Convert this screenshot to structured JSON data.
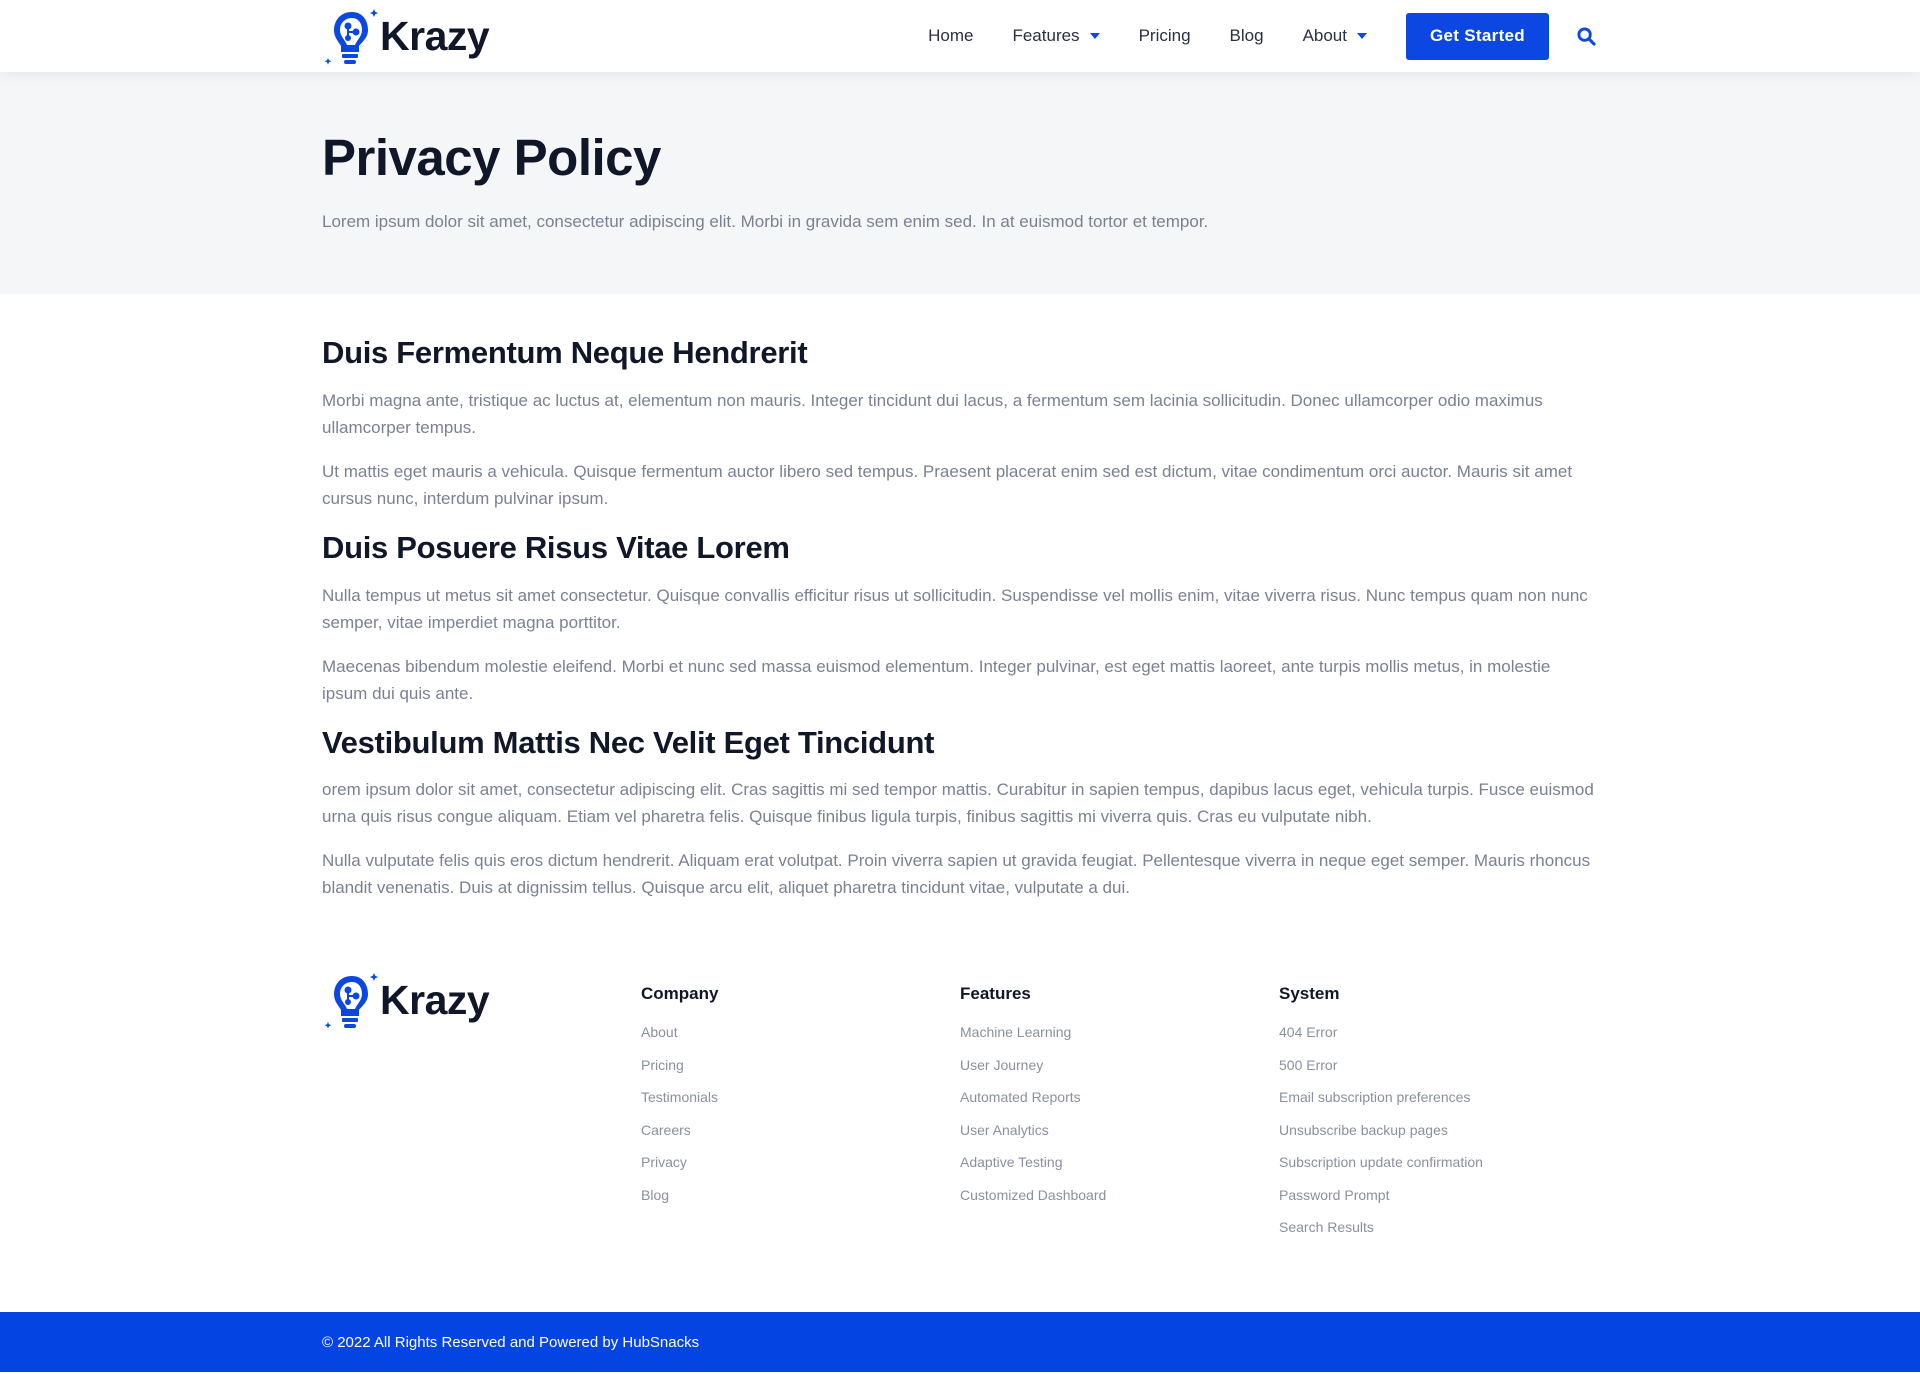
{
  "brand": {
    "name": "Krazy",
    "accent": "#0b47e0"
  },
  "nav": {
    "items": [
      {
        "label": "Home",
        "dropdown": false
      },
      {
        "label": "Features",
        "dropdown": true
      },
      {
        "label": "Pricing",
        "dropdown": false
      },
      {
        "label": "Blog",
        "dropdown": false
      },
      {
        "label": "About",
        "dropdown": true
      }
    ],
    "cta": "Get Started"
  },
  "hero": {
    "title": "Privacy Policy",
    "subtitle": "Lorem ipsum dolor sit amet, consectetur adipiscing elit. Morbi in gravida sem enim sed. In at euismod tortor et tempor."
  },
  "sections": [
    {
      "heading": "Duis Fermentum Neque Hendrerit",
      "paragraphs": [
        "Morbi magna ante, tristique ac luctus at, elementum non mauris. Integer tincidunt dui lacus, a fermentum sem lacinia sollicitudin. Donec ullamcorper odio maximus ullamcorper tempus.",
        "Ut mattis eget mauris a vehicula. Quisque fermentum auctor libero sed tempus. Praesent placerat enim sed est dictum, vitae condimentum orci auctor. Mauris sit amet cursus nunc, interdum pulvinar ipsum."
      ]
    },
    {
      "heading": "Duis Posuere Risus Vitae Lorem",
      "paragraphs": [
        "Nulla tempus ut metus sit amet consectetur. Quisque convallis efficitur risus ut sollicitudin. Suspendisse vel mollis enim, vitae viverra risus. Nunc tempus quam non nunc semper, vitae imperdiet magna porttitor.",
        "Maecenas bibendum molestie eleifend. Morbi et nunc sed massa euismod elementum. Integer pulvinar, est eget mattis laoreet, ante turpis mollis metus, in molestie ipsum dui quis ante."
      ]
    },
    {
      "heading": "Vestibulum Mattis Nec Velit Eget Tincidunt",
      "paragraphs": [
        "orem ipsum dolor sit amet, consectetur adipiscing elit. Cras sagittis mi sed tempor mattis. Curabitur in sapien tempus, dapibus lacus eget, vehicula turpis. Fusce euismod urna quis risus congue aliquam. Etiam vel pharetra felis. Quisque finibus ligula turpis, finibus sagittis mi viverra quis. Cras eu vulputate nibh.",
        "Nulla vulputate felis quis eros dictum hendrerit. Aliquam erat volutpat. Proin viverra sapien ut gravida feugiat. Pellentesque viverra in neque eget semper. Mauris rhoncus blandit venenatis. Duis at dignissim tellus. Quisque arcu elit, aliquet pharetra tincidunt vitae, vulputate a dui."
      ]
    }
  ],
  "footer": {
    "columns": [
      {
        "title": "Company",
        "links": [
          "About",
          "Pricing",
          "Testimonials",
          "Careers",
          "Privacy",
          "Blog"
        ]
      },
      {
        "title": "Features",
        "links": [
          "Machine Learning",
          "User Journey",
          "Automated Reports",
          "User Analytics",
          "Adaptive Testing",
          "Customized Dashboard"
        ]
      },
      {
        "title": "System",
        "links": [
          "404 Error",
          "500 Error",
          "Email subscription preferences",
          "Unsubscribe backup pages",
          "Subscription update confirmation",
          "Password Prompt",
          "Search Results"
        ]
      }
    ],
    "copyright": "© 2022 All Rights Reserved and Powered by HubSnacks"
  }
}
